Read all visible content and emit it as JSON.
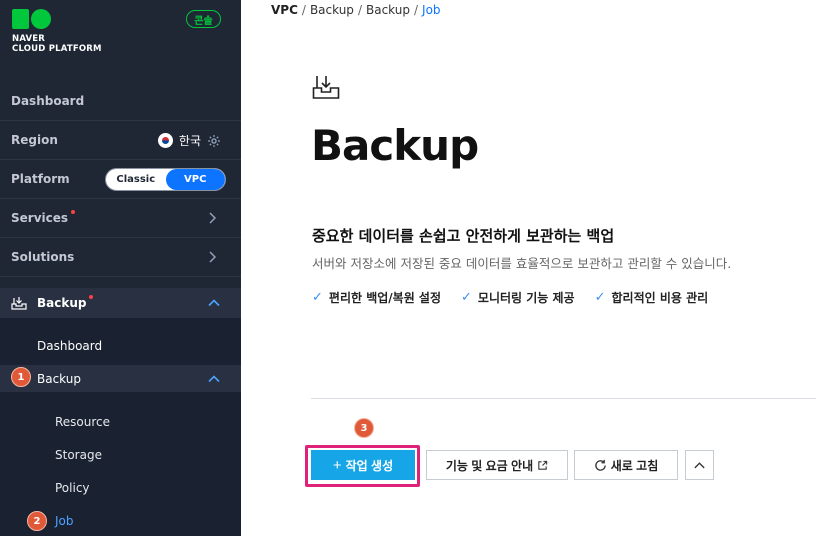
{
  "brand": {
    "logo_line1": "NAVER",
    "logo_line2": "CLOUD PLATFORM",
    "console_label": "콘솔",
    "green": "#00c73c"
  },
  "sidebar": {
    "dashboard": "Dashboard",
    "region": {
      "label": "Region",
      "value": "한국",
      "flag_icon": "korea-flag-icon",
      "settings_icon": "gear-icon"
    },
    "platform": {
      "label": "Platform",
      "options": [
        "Classic",
        "VPC"
      ],
      "selected": "VPC"
    },
    "services": "Services",
    "solutions": "Solutions",
    "backup": {
      "label": "Backup",
      "items": {
        "dashboard": "Dashboard",
        "backup": "Backup",
        "resource": "Resource",
        "storage": "Storage",
        "policy": "Policy",
        "job": "Job"
      }
    }
  },
  "steps": {
    "one": "1",
    "two": "2",
    "three": "3"
  },
  "breadcrumb": {
    "root": "VPC",
    "b1": "Backup",
    "b2": "Backup",
    "current": "Job",
    "sep": "/"
  },
  "main": {
    "title": "Backup",
    "headline": "중요한 데이터를 손쉽고 안전하게 보관하는 백업",
    "subline": "서버와 저장소에 저장된 중요 데이터를 효율적으로 보관하고 관리할 수 있습니다.",
    "features": [
      "편리한 백업/복원 설정",
      "모니터링 기능 제공",
      "합리적인 비용 관리"
    ]
  },
  "actions": {
    "create": "작업 생성",
    "info": "기능 및 요금 안내",
    "refresh": "새로 고침"
  },
  "colors": {
    "accent": "#0c74ff",
    "primary_button": "#16a6e8",
    "highlight": "#e0217a",
    "step_badge": "#e05a3a"
  }
}
